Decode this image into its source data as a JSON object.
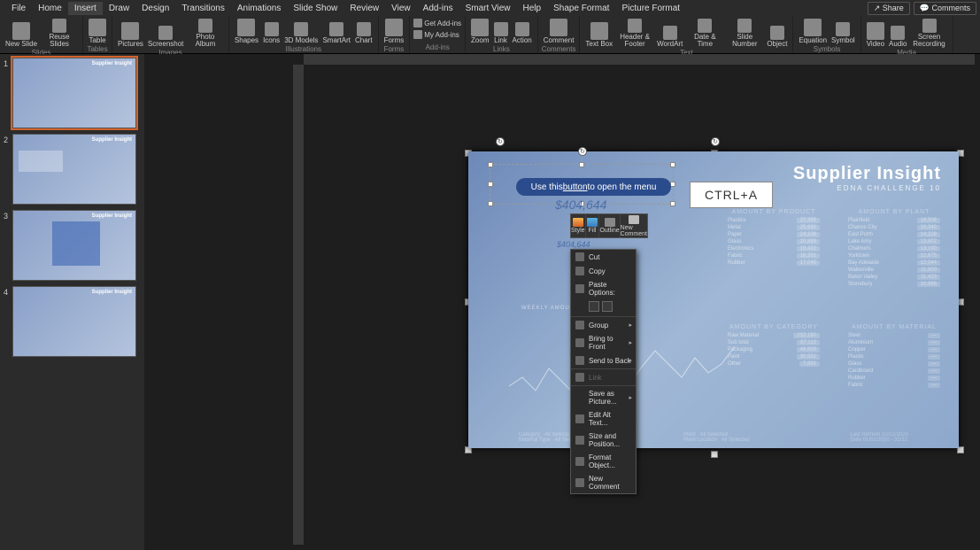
{
  "tabs": {
    "file": "File",
    "home": "Home",
    "insert": "Insert",
    "draw": "Draw",
    "design": "Design",
    "transitions": "Transitions",
    "animations": "Animations",
    "slideshow": "Slide Show",
    "review": "Review",
    "view": "View",
    "addins": "Add-ins",
    "smartview": "Smart View",
    "help": "Help",
    "shapeformat": "Shape Format",
    "pictureformat": "Picture Format",
    "share": "Share",
    "comments": "Comments"
  },
  "ribbon": {
    "slides": {
      "new_slide": "New Slide",
      "reuse": "Reuse Slides",
      "group": "Slides"
    },
    "tables": {
      "table": "Table",
      "group": "Tables"
    },
    "images": {
      "pictures": "Pictures",
      "screenshot": "Screenshot",
      "album": "Photo Album",
      "group": "Images"
    },
    "illus": {
      "shapes": "Shapes",
      "icons": "Icons",
      "models": "3D Models",
      "smartart": "SmartArt",
      "chart": "Chart",
      "group": "Illustrations"
    },
    "forms": {
      "forms": "Forms",
      "group": "Forms"
    },
    "addins": {
      "get": "Get Add-ins",
      "my": "My Add-ins",
      "group": "Add-ins"
    },
    "links": {
      "zoom": "Zoom",
      "link": "Link",
      "action": "Action",
      "group": "Links"
    },
    "comments": {
      "comment": "Comment",
      "group": "Comments"
    },
    "text": {
      "textbox": "Text Box",
      "header": "Header & Footer",
      "wordart": "WordArt",
      "date": "Date & Time",
      "number": "Slide Number",
      "object": "Object",
      "group": "Text"
    },
    "symbols": {
      "equation": "Equation",
      "symbol": "Symbol",
      "group": "Symbols"
    },
    "media": {
      "video": "Video",
      "audio": "Audio",
      "screen": "Screen Recording",
      "group": "Media"
    }
  },
  "thumbs": {
    "n1": "1",
    "n2": "2",
    "n3": "3",
    "n4": "4",
    "mini_title": "Supplier Insight"
  },
  "slide": {
    "title": "Supplier Insight",
    "subtitle": "EDNA CHALLENGE 10",
    "callout_pre": "Use this ",
    "callout_u": "button",
    "callout_post": " to open the menu",
    "ctrla": "CTRL+A",
    "dollar": "$404,644",
    "dollar2": "$404,644",
    "table1_hdr": "AMOUNT BY PRODUCT",
    "table2_hdr": "AMOUNT BY PLANT",
    "table3_hdr": "AMOUNT BY CATEGORY",
    "table4_hdr": "AMOUNT BY MATERIAL",
    "t1": [
      [
        "Plastics",
        "27,395"
      ],
      [
        "Metal",
        "25,930"
      ],
      [
        "Paper",
        "24,108"
      ],
      [
        "Glass",
        "20,899"
      ],
      [
        "Electronics",
        "19,432"
      ],
      [
        "Fabric",
        "18,201"
      ],
      [
        "Rubber",
        "17,045"
      ]
    ],
    "t2": [
      [
        "Plainfield",
        "18,506"
      ],
      [
        "Chance City",
        "15,340"
      ],
      [
        "East Porth",
        "14,228"
      ],
      [
        "Lake Amy",
        "13,802"
      ],
      [
        "Chalmers",
        "13,190"
      ],
      [
        "Yorktown",
        "12,675"
      ],
      [
        "Bay Adelaide",
        "12,044"
      ],
      [
        "Walkerville",
        "11,900"
      ],
      [
        "Baton Valley",
        "11,423"
      ],
      [
        "Stonebury",
        "10,998"
      ]
    ],
    "t3": [
      [
        "Raw Material",
        "232,180"
      ],
      [
        "Sub total",
        "87,113"
      ],
      [
        "Packaging",
        "46,808"
      ],
      [
        "Paint",
        "30,552"
      ],
      [
        "Other",
        "7,991"
      ]
    ],
    "t4": [
      [
        "Steel",
        "—"
      ],
      [
        "Aluminium",
        "—"
      ],
      [
        "Copper",
        "—"
      ],
      [
        "Plastic",
        "—"
      ],
      [
        "Glass",
        "—"
      ],
      [
        "Cardboard",
        "—"
      ],
      [
        "Rubber",
        "—"
      ],
      [
        "Fabric",
        "—"
      ]
    ],
    "footer": {
      "cat_lbl": "Category",
      "cat_val": "All Selected",
      "mat_lbl": "Material Type",
      "mat_val": "All Selected",
      "plant_lbl": "Plant",
      "plant_val": "All Selected",
      "loc_lbl": "Plant Location",
      "loc_val": "All Selected",
      "upd_lbl": "Last Refresh 10/12/2020",
      "gen_lbl": "Date 01/01/2020 - 31/12"
    },
    "weekly": "WEEKLY AMOUNT"
  },
  "minitool": {
    "style": "Style",
    "fill": "Fill",
    "outline": "Outline",
    "comment": "New Comment"
  },
  "menu": {
    "cut": "Cut",
    "copy": "Copy",
    "paste_opt": "Paste Options:",
    "group": "Group",
    "front": "Bring to Front",
    "back": "Send to Back",
    "link": "Link",
    "save_pic": "Save as Picture...",
    "alt": "Edit Alt Text...",
    "size": "Size and Position...",
    "format": "Format Object...",
    "newc": "New Comment"
  }
}
